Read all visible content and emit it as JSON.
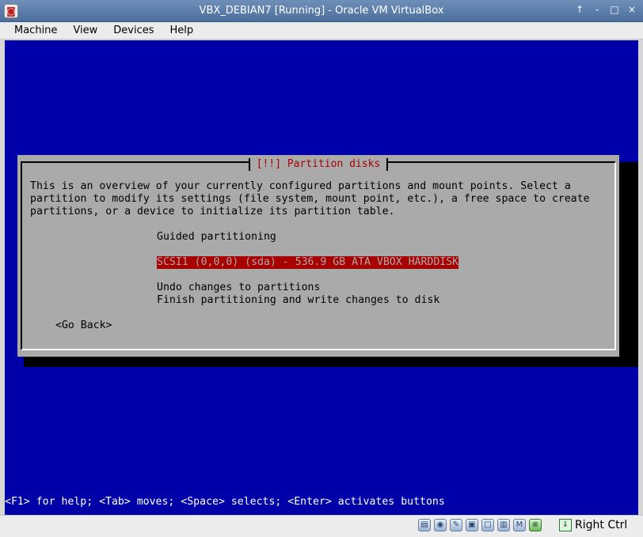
{
  "window": {
    "title": "VBX_DEBIAN7 [Running] - Oracle VM VirtualBox",
    "controls": [
      "↑",
      "-",
      "□",
      "×"
    ]
  },
  "menu": [
    "Machine",
    "View",
    "Devices",
    "Help"
  ],
  "dialog": {
    "title": "[!!] Partition disks",
    "description": [
      "This is an overview of your currently configured partitions and mount points. Select a",
      "partition to modify its settings (file system, mount point, etc.), a free space to create",
      "partitions, or a device to initialize its partition table."
    ],
    "options": [
      "Guided partitioning",
      "SCSI1 (0,0,0) (sda) - 536.9 GB ATA VBOX HARDDISK",
      "Undo changes to partitions",
      "Finish partitioning and write changes to disk"
    ],
    "selected_option": 1,
    "go_back": "<Go Back>"
  },
  "helpline": "<F1> for help; <Tab> moves; <Space> selects; <Enter> activates buttons",
  "statusbar": {
    "icons": [
      "hard-disk-icon",
      "optical-drive-icon",
      "usb-icon",
      "shared-folders-icon",
      "display-icon",
      "video-capture-icon",
      "network-icon",
      "cpu-icon",
      "mouse-integration-icon"
    ],
    "host_key": "Right Ctrl"
  },
  "colors": {
    "screen_bg": "#0000a8",
    "dialog_bg": "#aaaaaa",
    "dialog_title": "#a80000",
    "selection_bg": "#a80000"
  }
}
